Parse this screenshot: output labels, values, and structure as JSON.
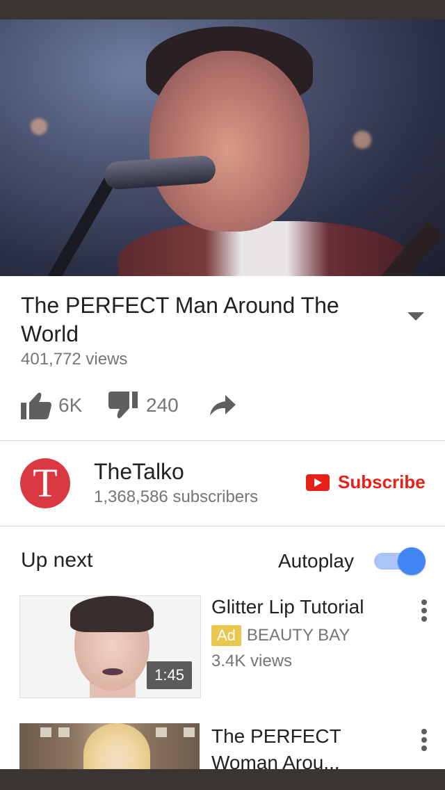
{
  "video": {
    "title": "The PERFECT Man Around The World",
    "views": "401,772 views",
    "likes": "6K",
    "dislikes": "240"
  },
  "channel": {
    "logo_letter": "T",
    "name": "TheTalko",
    "subscribers": "1,368,586 subscribers",
    "subscribe_label": "Subscribe"
  },
  "up_next": {
    "heading": "Up next",
    "autoplay_label": "Autoplay",
    "autoplay_on": true,
    "items": [
      {
        "title": "Glitter Lip Tutorial",
        "badge": "Ad",
        "channel": "BEAUTY BAY",
        "views": "3.4K views",
        "duration": "1:45"
      },
      {
        "title": "The PERFECT Woman Arou..."
      }
    ]
  },
  "colors": {
    "accent_red": "#e62117",
    "channel_logo": "#d93a42",
    "toggle_blue": "#4285f4",
    "ad_yellow": "#e8c74c"
  },
  "icons": [
    "thumbs-up-icon",
    "thumbs-down-icon",
    "share-icon",
    "chevron-down-icon",
    "youtube-play-icon",
    "more-vert-icon"
  ]
}
